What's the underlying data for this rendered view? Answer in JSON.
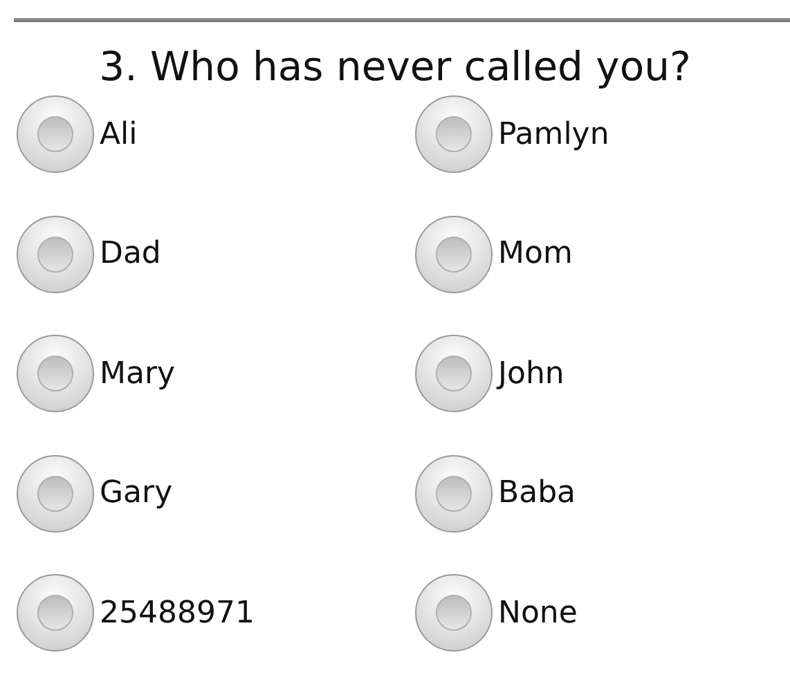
{
  "question": {
    "title": "3. Who has never called you?"
  },
  "options": [
    {
      "label": "Ali",
      "selected": false
    },
    {
      "label": "Pamlyn",
      "selected": false
    },
    {
      "label": "Dad",
      "selected": false
    },
    {
      "label": "Mom",
      "selected": false
    },
    {
      "label": "Mary",
      "selected": false
    },
    {
      "label": "John",
      "selected": false
    },
    {
      "label": "Gary",
      "selected": false
    },
    {
      "label": "Baba",
      "selected": false
    },
    {
      "label": "25488971",
      "selected": false
    },
    {
      "label": "None",
      "selected": false
    }
  ]
}
